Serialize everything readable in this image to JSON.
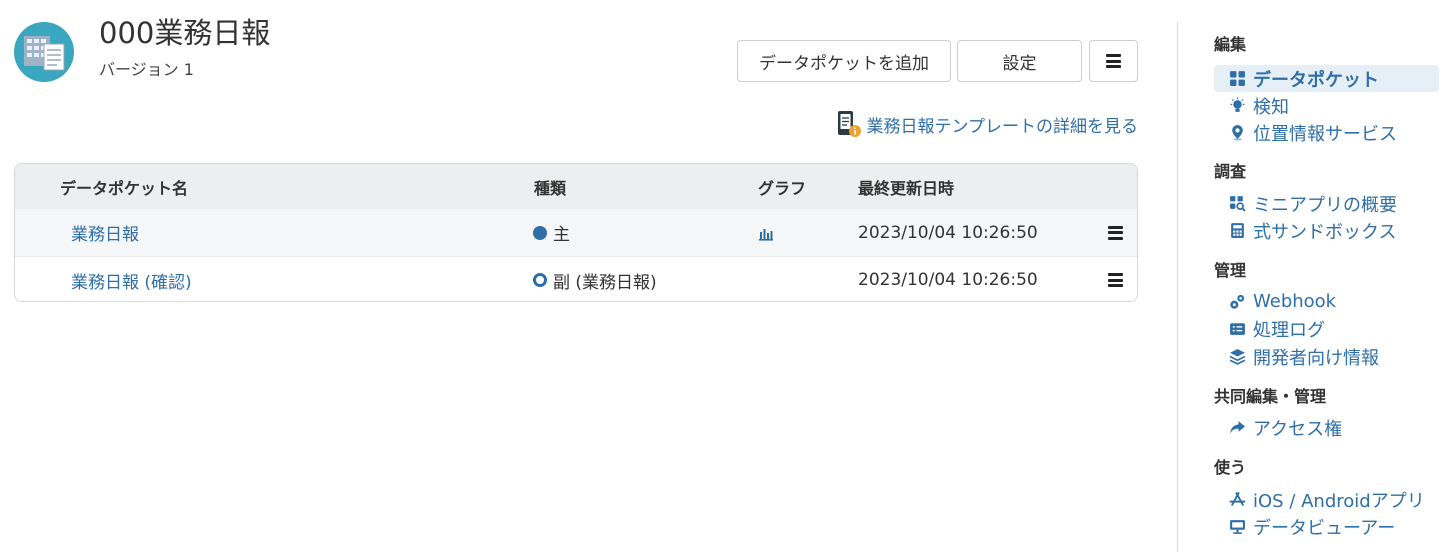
{
  "app": {
    "title": "000業務日報",
    "version": "バージョン 1"
  },
  "toolbar": {
    "add_label": "データポケットを追加",
    "settings_label": "設定"
  },
  "template_link": {
    "label": "業務日報テンプレートの詳細を見る"
  },
  "table": {
    "headers": {
      "name": "データポケット名",
      "type": "種類",
      "graph": "グラフ",
      "updated": "最終更新日時"
    },
    "rows": [
      {
        "name": "業務日報",
        "type": "主",
        "has_graph": true,
        "updated": "2023/10/04 10:26:50"
      },
      {
        "name": "業務日報 (確認)",
        "type": "副 (業務日報)",
        "has_graph": false,
        "updated": "2023/10/04 10:26:50"
      }
    ]
  },
  "sidebar": {
    "sections": [
      {
        "heading": "編集",
        "items": [
          {
            "label": "データポケット",
            "icon": "grid-icon",
            "active": true
          },
          {
            "label": "検知",
            "icon": "lightbulb-icon"
          },
          {
            "label": "位置情報サービス",
            "icon": "map-pin-icon"
          }
        ]
      },
      {
        "heading": "調査",
        "items": [
          {
            "label": "ミニアプリの概要",
            "icon": "grid-search-icon"
          },
          {
            "label": "式サンドボックス",
            "icon": "calculator-icon"
          }
        ]
      },
      {
        "heading": "管理",
        "items": [
          {
            "label": "Webhook",
            "icon": "gears-icon"
          },
          {
            "label": "処理ログ",
            "icon": "log-icon"
          },
          {
            "label": "開発者向け情報",
            "icon": "layers-icon"
          }
        ]
      },
      {
        "heading": "共同編集・管理",
        "items": [
          {
            "label": "アクセス権",
            "icon": "share-arrow-icon"
          }
        ]
      },
      {
        "heading": "使う",
        "items": [
          {
            "label": "iOS / Androidアプリ",
            "icon": "app-store-icon"
          },
          {
            "label": "データビューアー",
            "icon": "monitor-icon"
          }
        ]
      }
    ]
  },
  "colors": {
    "link": "#2f6fa8",
    "active_bg": "#e6eef6",
    "table_header_bg": "#eceeef"
  }
}
